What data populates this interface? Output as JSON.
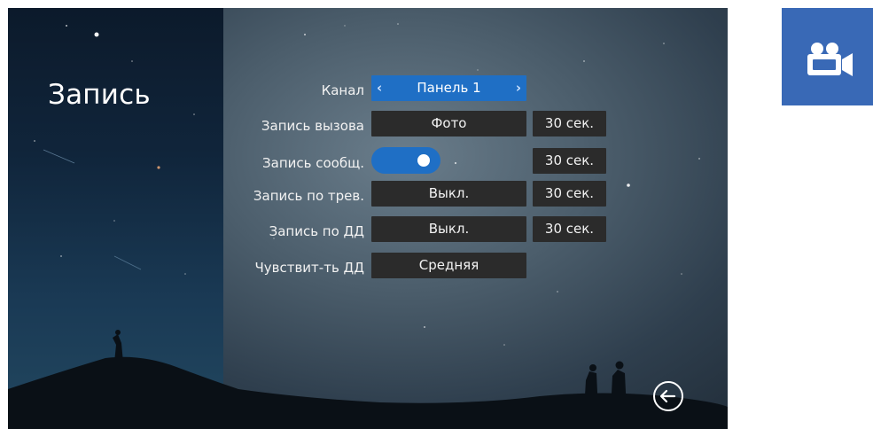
{
  "page": {
    "title": "Запись"
  },
  "rows": [
    {
      "label": "Канал",
      "value": "Панель 1",
      "selected": true
    },
    {
      "label": "Запись вызова",
      "value": "Фото",
      "duration": "30 сек."
    },
    {
      "label": "Запись сообщ.",
      "toggle_on": true,
      "duration": "30 сек."
    },
    {
      "label": "Запись по трев.",
      "value": "Выкл.",
      "duration": "30 сек."
    },
    {
      "label": "Запись по ДД",
      "value": "Выкл.",
      "duration": "30 сек."
    },
    {
      "label": "Чувствит-ть ДД",
      "value": "Средняя"
    }
  ],
  "icons": {
    "back": "back-arrow-icon",
    "side": "video-camera-icon",
    "prev": "chevron-left-icon",
    "next": "chevron-right-icon"
  },
  "colors": {
    "accent": "#1f6fc5",
    "field_bg": "#2b2b2b",
    "side_tile": "#3969b6"
  }
}
